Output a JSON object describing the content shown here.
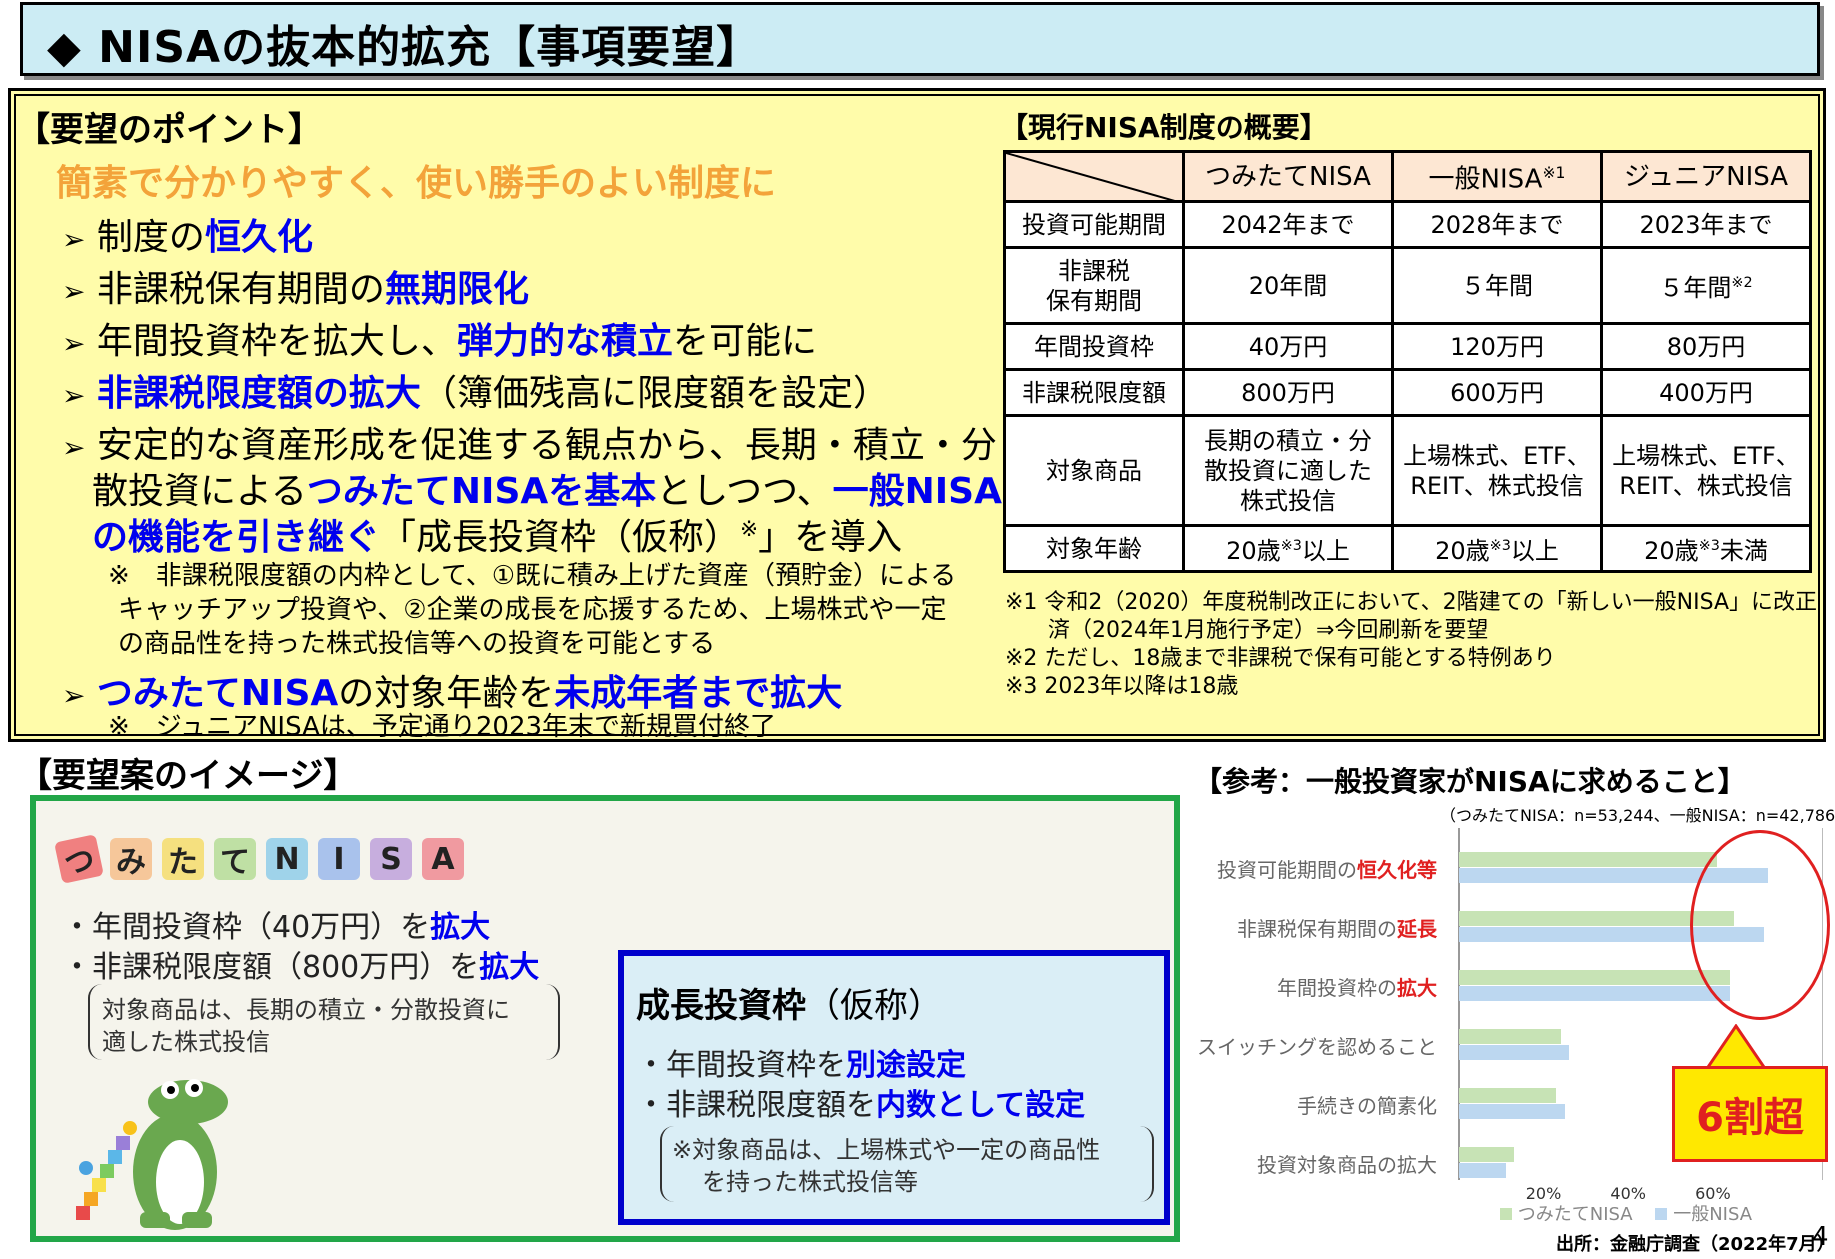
{
  "header": {
    "title": "◆ NISAの抜本的拡充【事項要望】"
  },
  "points": {
    "heading": "【要望のポイント】",
    "slogan": "簡素で分かりやすく、使い勝手のよい制度に",
    "items": [
      {
        "a": "制度の",
        "b": "恒久化"
      },
      {
        "a": "非課税保有期間の",
        "b": "無期限化"
      },
      {
        "a": "年間投資枠を拡大し、",
        "b": "弾力的な積立",
        "c": "を可能に"
      },
      {
        "b": "非課税限度額の拡大",
        "c": "（簿価残高に限度額を設定）"
      },
      {
        "a1": "安定的な資産形成を促進する観点から、長期・積立・分",
        "a2": "散投資による",
        "b1": "つみたてNISAを基本",
        "c1": "としつつ、",
        "b2": "一般NISA",
        "b3": "の機能を引き継ぐ",
        "c2": "「成長投資枠（仮称）",
        "c3": "」を導入"
      },
      {
        "b": "つみたてNISA",
        "a": "の対象年齢を",
        "b2": "未成年者まで拡大"
      }
    ],
    "note1": [
      "※　非課税限度額の内枠として、①既に積み上げた資産（預貯金）による",
      "キャッチアップ投資や、②企業の成長を応援するため、上場株式や一定",
      "の商品性を持った株式投信等への投資を可能とする"
    ],
    "note2": "※　ジュニアNISAは、予定通り2023年末で新規買付終了"
  },
  "table": {
    "heading": "【現行NISA制度の概要】",
    "columns": [
      "つみたてNISA",
      "一般NISA",
      "ジュニアNISA"
    ],
    "rows": [
      {
        "label": "投資可能期間",
        "values": [
          "2042年まで",
          "2028年まで",
          "2023年まで"
        ]
      },
      {
        "label1": "非課税",
        "label2": "保有期間",
        "values": [
          "20年間",
          "５年間",
          "５年間"
        ]
      },
      {
        "label": "年間投資枠",
        "values": [
          "40万円",
          "120万円",
          "80万円"
        ]
      },
      {
        "label": "非課税限度額",
        "values": [
          "800万円",
          "600万円",
          "400万円"
        ]
      },
      {
        "label": "対象商品",
        "values": [
          [
            "長期の積立・分",
            "散投資に適した",
            "株式投信"
          ],
          [
            "上場株式、ETF、",
            "REIT、株式投信"
          ],
          [
            "上場株式、ETF、",
            "REIT、株式投信"
          ]
        ]
      },
      {
        "label": "対象年齢",
        "values": [
          "20歳",
          "20歳",
          "20歳"
        ],
        "suffix": [
          "以上",
          "以上",
          "未満"
        ]
      }
    ],
    "marks": {
      "m1": "※1",
      "m2": "※2",
      "m3": "※3"
    },
    "footnotes": [
      "※1 令和2（2020）年度税制改正において、2階建ての「新しい一般NISA」に改正",
      "済（2024年1月施行予定）⇒今回刷新を要望",
      "※2 ただし、18歳まで非課税で保有可能とする特例あり",
      "※3 2023年以降は18歳"
    ]
  },
  "image": {
    "heading": "【要望案のイメージ】",
    "tiles": [
      "つ",
      "み",
      "た",
      "て",
      "N",
      "I",
      "S",
      "A"
    ],
    "tile_colors": [
      "#f08080",
      "#f6c79a",
      "#f5e07f",
      "#bfe0a4",
      "#9fd3ea",
      "#a9c2ec",
      "#c7aede",
      "#f09aa0"
    ],
    "tsumitate_items": [
      {
        "a": "・年間投資枠（40万円）を",
        "b": "拡大"
      },
      {
        "a": "・非課税限度額（800万円）を",
        "b": "拡大"
      }
    ],
    "tsumitate_note": [
      "対象商品は、長期の積立・分散投資に",
      "適した株式投信"
    ],
    "growth_title": "成長投資枠",
    "growth_suffix": "（仮称）",
    "growth_items": [
      {
        "a": "・年間投資枠を",
        "b": "別途設定"
      },
      {
        "a": "・非課税限度額を",
        "b": "内数として設定"
      }
    ],
    "growth_note": [
      "※対象商品は、上場株式や一定の商品性",
      "を持った株式投信等"
    ]
  },
  "chart_data": {
    "type": "bar",
    "title": "【参考：一般投資家がNISAに求めること】",
    "subtitle": "（つみたてNISA：n=53,244、一般NISA：n=42,786）",
    "categories": [
      {
        "a": "投資可能期間の",
        "b": "恒久化等"
      },
      {
        "a": "非課税保有期間の",
        "b": "延長"
      },
      {
        "a": "年間投資枠の",
        "b": "拡大"
      },
      {
        "a": "スイッチングを認めること",
        "b": ""
      },
      {
        "a": "手続きの簡素化",
        "b": ""
      },
      {
        "a": "投資対象商品の拡大",
        "b": ""
      }
    ],
    "series": [
      {
        "name": "つみたてNISA",
        "values": [
          61,
          65,
          64,
          24,
          23,
          13
        ]
      },
      {
        "name": "一般NISA",
        "values": [
          73,
          72,
          64,
          26,
          25,
          11
        ]
      }
    ],
    "ticks": [
      "20%",
      "40%",
      "60%"
    ],
    "xlim": [
      0,
      85
    ],
    "callout": "6割超",
    "source": "出所：金融庁調査（2022年7月）",
    "colors": {
      "tsumitate": "#c7e3b5",
      "ippan": "#bcd7f0"
    }
  },
  "page_number": "4"
}
